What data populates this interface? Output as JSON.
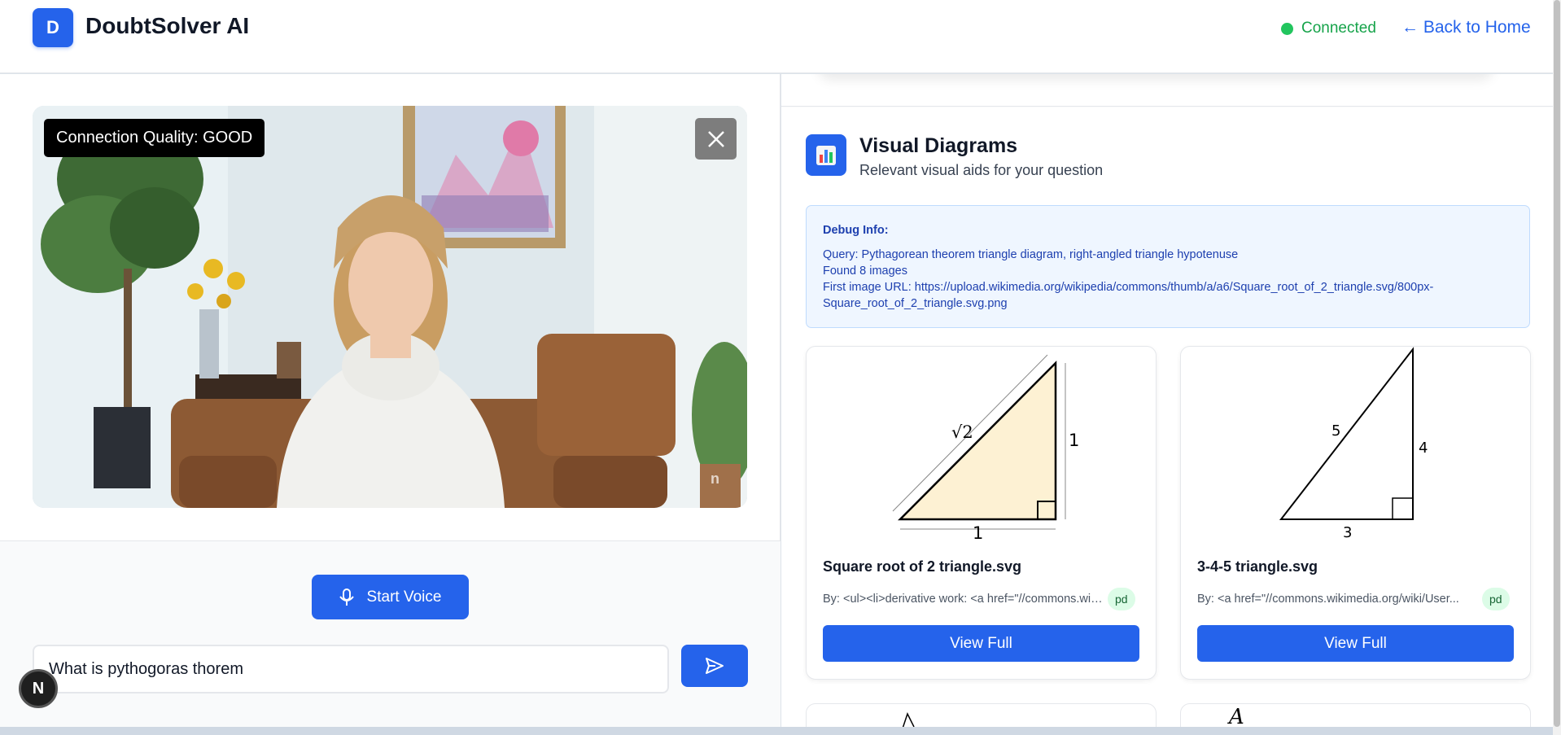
{
  "header": {
    "logo_letter": "D",
    "title": "DoubtSolver AI",
    "status": "Connected",
    "back_link": "← Back to Home"
  },
  "video": {
    "quality_label": "Connection Quality: GOOD",
    "watermark": "n"
  },
  "controls": {
    "voice_button": "Start Voice",
    "input_value": "What is pythogoras thorem",
    "n_badge": "N"
  },
  "visual": {
    "title": "Visual Diagrams",
    "subtitle": "Relevant visual aids for your question"
  },
  "debug": {
    "title": "Debug Info:",
    "query": "Query: Pythagorean theorem triangle diagram, right-angled triangle hypotenuse",
    "found": "Found 8 images",
    "url": "First image URL: https://upload.wikimedia.org/wikipedia/commons/thumb/a/a6/Square_root_of_2_triangle.svg/800px-Square_root_of_2_triangle.svg.png"
  },
  "cards": [
    {
      "title": "Square root of 2 triangle.svg",
      "by": "By: <ul><li>derivative work: <a href=\"//commons.wikimedia.org/wiki/User...",
      "license": "pd",
      "button": "View Full",
      "labels": {
        "hyp": "√2",
        "base": "1",
        "side": "1"
      }
    },
    {
      "title": "3-4-5 triangle.svg",
      "by": "By: <a href=\"//commons.wikimedia.org/wiki/User...",
      "license": "pd",
      "button": "View Full",
      "labels": {
        "hyp": "5",
        "side": "4",
        "base": "3"
      }
    }
  ],
  "stub_cards": [
    {
      "glyph": ""
    },
    {
      "glyph": "A"
    }
  ],
  "colors": {
    "accent": "#2563eb",
    "status_green": "#16a34a",
    "triangle_fill": "#fdf1d3"
  }
}
